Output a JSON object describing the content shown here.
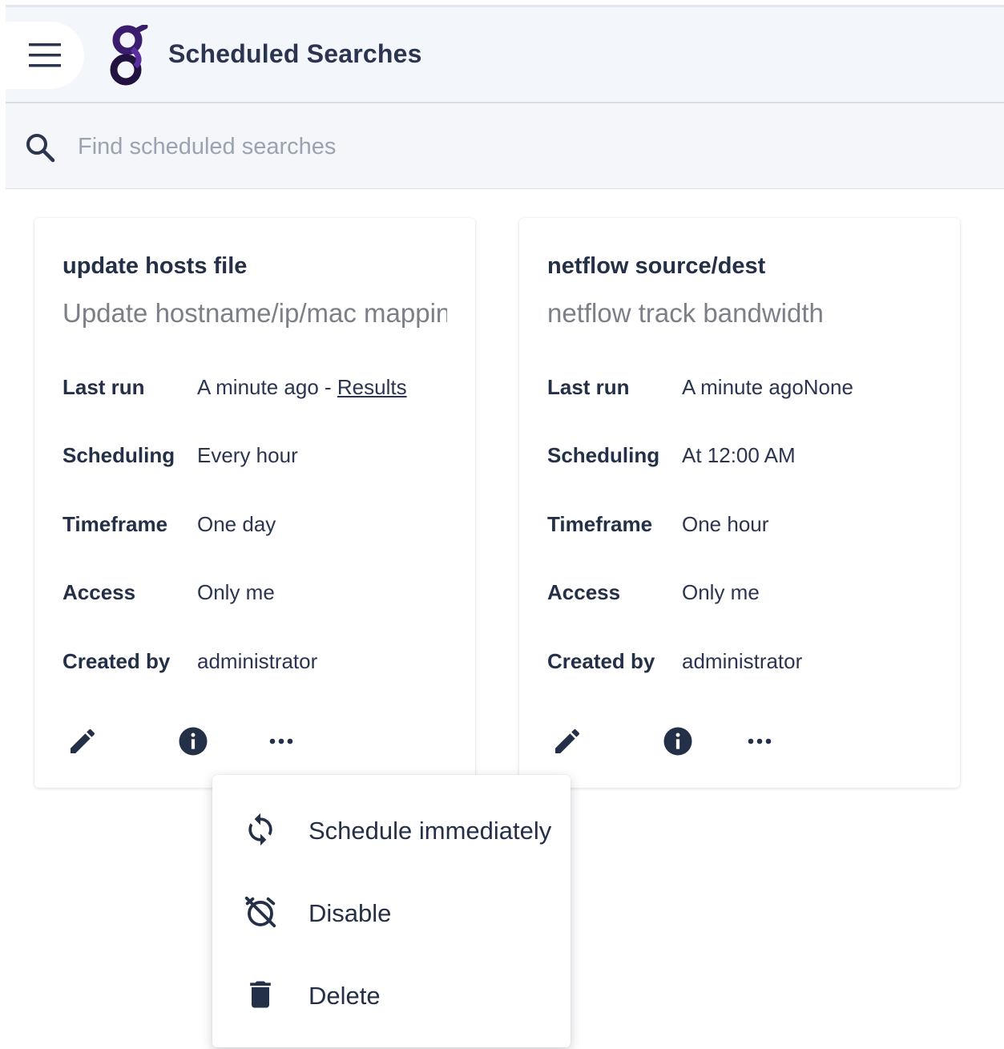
{
  "header": {
    "title": "Scheduled Searches",
    "menu_icon": "hamburger-menu-icon",
    "logo": "gravwell-logo"
  },
  "search": {
    "placeholder": "Find scheduled searches",
    "value": "",
    "icon": "search-icon"
  },
  "cards": [
    {
      "title": "update hosts file",
      "description": "Update hostname/ip/mac mapping",
      "fields": [
        {
          "label": "Last run",
          "value": "A minute ago - ",
          "link": "Results"
        },
        {
          "label": "Scheduling",
          "value": "Every hour"
        },
        {
          "label": "Timeframe",
          "value": "One day"
        },
        {
          "label": "Access",
          "value": "Only me"
        },
        {
          "label": "Created by",
          "value": "administrator"
        }
      ]
    },
    {
      "title": "netflow source/dest",
      "description": "netflow track bandwidth",
      "fields": [
        {
          "label": "Last run",
          "value": "A minute agoNone"
        },
        {
          "label": "Scheduling",
          "value": "At 12:00 AM"
        },
        {
          "label": "Timeframe",
          "value": "One hour"
        },
        {
          "label": "Access",
          "value": "Only me"
        },
        {
          "label": "Created by",
          "value": "administrator"
        }
      ]
    }
  ],
  "card_actions": [
    "pencil-icon",
    "info-icon",
    "more-horiz-icon"
  ],
  "menu": {
    "items": [
      {
        "label": "Schedule immediately",
        "icon": "sync-icon"
      },
      {
        "label": "Disable",
        "icon": "alarm-off-icon"
      },
      {
        "label": "Delete",
        "icon": "trash-icon"
      }
    ]
  },
  "colors": {
    "appbar_bg": "#f3f6fb",
    "text_primary": "#243047",
    "text_secondary": "#7a7f88",
    "logo_purple": "#3b1d6e"
  }
}
